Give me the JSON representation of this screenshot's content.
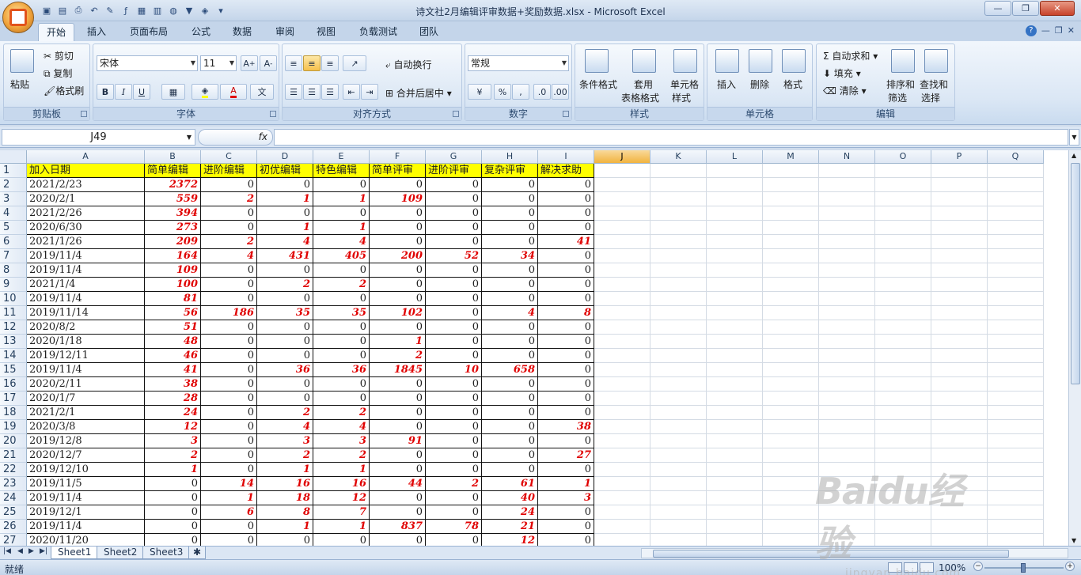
{
  "window": {
    "title": "诗文社2月编辑评审数据+奖励数据.xlsx - Microsoft Excel"
  },
  "ribbon_tabs": [
    "开始",
    "插入",
    "页面布局",
    "公式",
    "数据",
    "审阅",
    "视图",
    "负载测试",
    "团队"
  ],
  "clipboard": {
    "paste": "粘贴",
    "cut": "剪切",
    "copy": "复制",
    "format_painter": "格式刷",
    "label": "剪贴板"
  },
  "font": {
    "name": "宋体",
    "size": "11",
    "bold": "B",
    "italic": "I",
    "underline": "U",
    "label": "字体"
  },
  "alignment": {
    "wrap": "自动换行",
    "merge": "合并后居中",
    "label": "对齐方式"
  },
  "number": {
    "format": "常规",
    "percent": "%",
    "comma": ",",
    "label": "数字"
  },
  "styles": {
    "conditional": "条件格式",
    "table1": "套用",
    "table2": "表格格式",
    "cell1": "单元格",
    "cell2": "样式",
    "label": "样式"
  },
  "cells": {
    "insert": "插入",
    "delete": "删除",
    "format": "格式",
    "label": "单元格"
  },
  "editing": {
    "autosum": "自动求和",
    "fill": "填充",
    "clear": "清除",
    "sort1": "排序和",
    "sort2": "筛选",
    "find1": "查找和",
    "find2": "选择",
    "label": "编辑"
  },
  "formula_bar": {
    "name_box": "J49",
    "fx": "fx",
    "content": ""
  },
  "columns": [
    "A",
    "B",
    "C",
    "D",
    "E",
    "F",
    "G",
    "H",
    "I",
    "J",
    "K",
    "L",
    "M",
    "N",
    "O",
    "P",
    "Q"
  ],
  "headers": [
    "加入日期",
    "简单编辑",
    "进阶编辑",
    "初优编辑",
    "特色编辑",
    "简单评审",
    "进阶评审",
    "复杂评审",
    "解决求助"
  ],
  "rows": [
    [
      "2021/2/23",
      "2372",
      "0",
      "0",
      "0",
      "0",
      "0",
      "0",
      "0"
    ],
    [
      "2020/2/1",
      "559",
      "2",
      "1",
      "1",
      "109",
      "0",
      "0",
      "0"
    ],
    [
      "2021/2/26",
      "394",
      "0",
      "0",
      "0",
      "0",
      "0",
      "0",
      "0"
    ],
    [
      "2020/6/30",
      "273",
      "0",
      "1",
      "1",
      "0",
      "0",
      "0",
      "0"
    ],
    [
      "2021/1/26",
      "209",
      "2",
      "4",
      "4",
      "0",
      "0",
      "0",
      "41"
    ],
    [
      "2019/11/4",
      "164",
      "4",
      "431",
      "405",
      "200",
      "52",
      "34",
      "0"
    ],
    [
      "2019/11/4",
      "109",
      "0",
      "0",
      "0",
      "0",
      "0",
      "0",
      "0"
    ],
    [
      "2021/1/4",
      "100",
      "0",
      "2",
      "2",
      "0",
      "0",
      "0",
      "0"
    ],
    [
      "2019/11/4",
      "81",
      "0",
      "0",
      "0",
      "0",
      "0",
      "0",
      "0"
    ],
    [
      "2019/11/14",
      "56",
      "186",
      "35",
      "35",
      "102",
      "0",
      "4",
      "8"
    ],
    [
      "2020/8/2",
      "51",
      "0",
      "0",
      "0",
      "0",
      "0",
      "0",
      "0"
    ],
    [
      "2020/1/18",
      "48",
      "0",
      "0",
      "0",
      "1",
      "0",
      "0",
      "0"
    ],
    [
      "2019/12/11",
      "46",
      "0",
      "0",
      "0",
      "2",
      "0",
      "0",
      "0"
    ],
    [
      "2019/11/4",
      "41",
      "0",
      "36",
      "36",
      "1845",
      "10",
      "658",
      "0"
    ],
    [
      "2020/2/11",
      "38",
      "0",
      "0",
      "0",
      "0",
      "0",
      "0",
      "0"
    ],
    [
      "2020/1/7",
      "28",
      "0",
      "0",
      "0",
      "0",
      "0",
      "0",
      "0"
    ],
    [
      "2021/2/1",
      "24",
      "0",
      "2",
      "2",
      "0",
      "0",
      "0",
      "0"
    ],
    [
      "2020/3/8",
      "12",
      "0",
      "4",
      "4",
      "0",
      "0",
      "0",
      "38"
    ],
    [
      "2019/12/8",
      "3",
      "0",
      "3",
      "3",
      "91",
      "0",
      "0",
      "0"
    ],
    [
      "2020/12/7",
      "2",
      "0",
      "2",
      "2",
      "0",
      "0",
      "0",
      "27"
    ],
    [
      "2019/12/10",
      "1",
      "0",
      "1",
      "1",
      "0",
      "0",
      "0",
      "0"
    ],
    [
      "2019/11/5",
      "0",
      "14",
      "16",
      "16",
      "44",
      "2",
      "61",
      "1"
    ],
    [
      "2019/11/4",
      "0",
      "1",
      "18",
      "12",
      "0",
      "0",
      "40",
      "3"
    ],
    [
      "2019/12/1",
      "0",
      "6",
      "8",
      "7",
      "0",
      "0",
      "24",
      "0"
    ],
    [
      "2019/11/4",
      "0",
      "0",
      "1",
      "1",
      "837",
      "78",
      "21",
      "0"
    ],
    [
      "2020/11/20",
      "0",
      "0",
      "0",
      "0",
      "0",
      "0",
      "12",
      "0"
    ]
  ],
  "sheets": [
    "Sheet1",
    "Sheet2",
    "Sheet3"
  ],
  "status": {
    "ready": "就绪",
    "zoom": "100%"
  },
  "watermark": {
    "line1": "Baidu经验",
    "line2": "jingyan.baidu.com"
  }
}
